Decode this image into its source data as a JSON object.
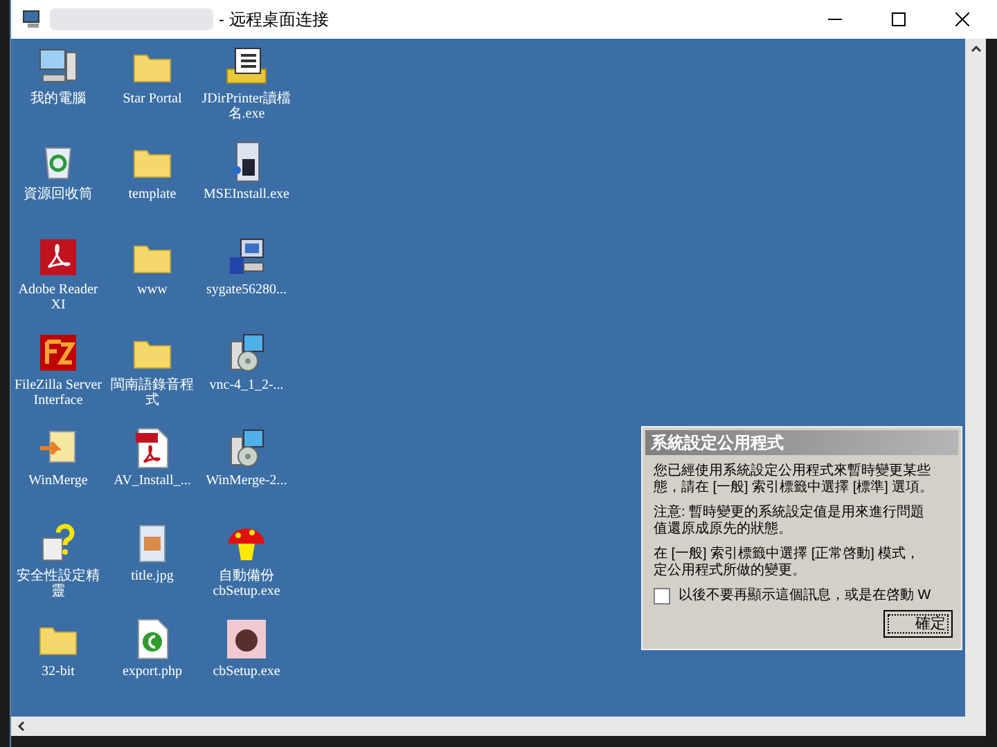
{
  "window": {
    "title": "- 远程桌面连接"
  },
  "desktop_icons": [
    {
      "kind": "computer",
      "label": "我的電腦"
    },
    {
      "kind": "folder",
      "label": "Star Portal"
    },
    {
      "kind": "document",
      "label": "JDirPrinter讀檔名.exe"
    },
    {
      "kind": "recycle",
      "label": "資源回收筒"
    },
    {
      "kind": "folder",
      "label": "template"
    },
    {
      "kind": "installer",
      "label": "MSEInstall.exe"
    },
    {
      "kind": "pdf",
      "label": "Adobe Reader XI"
    },
    {
      "kind": "folder",
      "label": "www"
    },
    {
      "kind": "setup",
      "label": "sygate56280..."
    },
    {
      "kind": "filezilla",
      "label": "FileZilla Server Interface"
    },
    {
      "kind": "folder",
      "label": "閩南語錄音程式"
    },
    {
      "kind": "cd",
      "label": "vnc-4_1_2-..."
    },
    {
      "kind": "merge",
      "label": "WinMerge"
    },
    {
      "kind": "pdffile",
      "label": "AV_Install_..."
    },
    {
      "kind": "cd",
      "label": "WinMerge-2..."
    },
    {
      "kind": "help",
      "label": "安全性設定精靈"
    },
    {
      "kind": "image",
      "label": "title.jpg"
    },
    {
      "kind": "mushroom",
      "label": "自動備份cbSetup.exe"
    },
    {
      "kind": "folder",
      "label": "32-bit"
    },
    {
      "kind": "php",
      "label": "export.php"
    },
    {
      "kind": "photo",
      "label": "cbSetup.exe"
    }
  ],
  "dialog": {
    "title": "系統設定公用程式",
    "paragraphs": [
      [
        "您已經使用系統設定公用程式來暫時變更某些",
        "態，請在 [一般] 索引標籤中選擇 [標準] 選項。"
      ],
      [
        "注意: 暫時變更的系統設定值是用來進行問題",
        "值還原成原先的狀態。"
      ],
      [
        "在 [一般] 索引標籤中選擇 [正常啓動] 模式，",
        "定公用程式所做的變更。"
      ]
    ],
    "checkbox": {
      "label": "以後不要再顯示這個訊息，或是在啓動 W",
      "checked": false
    },
    "button": "確定"
  }
}
